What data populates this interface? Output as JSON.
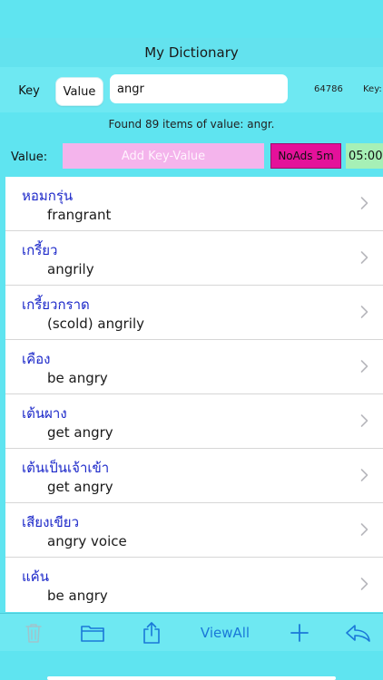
{
  "header": {
    "title": "My Dictionary"
  },
  "segment": {
    "key_label": "Key",
    "value_label": "Value",
    "selected": "Value"
  },
  "search": {
    "value": "angr",
    "placeholder": ""
  },
  "stats": {
    "count": "64786",
    "key_label_partial": "Key:"
  },
  "found_text": "Found 89 items of value: angr.",
  "value_row": {
    "label": "Value:",
    "placeholder": "Add Key-Value",
    "noads_label": "NoAds 5m",
    "timer": "05:00"
  },
  "entries": [
    {
      "key": "หอมกรุ่น",
      "value": "frangrant"
    },
    {
      "key": "เกรี้ยว",
      "value": "angrily"
    },
    {
      "key": "เกรี้ยวกราด",
      "value": "(scold) angrily"
    },
    {
      "key": "เคือง",
      "value": "be angry"
    },
    {
      "key": "เต้นผาง",
      "value": "get angry"
    },
    {
      "key": "เต้นเป็นเจ้าเข้า",
      "value": "get angry"
    },
    {
      "key": "เสียงเขียว",
      "value": "angry voice"
    },
    {
      "key": "แค้น",
      "value": "be angry"
    }
  ],
  "toolbar": {
    "viewall_label": "ViewAll",
    "icons": [
      "trash-icon",
      "folder-icon",
      "share-icon",
      "plus-icon",
      "reply-icon"
    ]
  },
  "colors": {
    "background": "#5fe4f0",
    "key_text": "#1b27c9",
    "accent": "#1a78d8",
    "value_field": "#f4b4ec",
    "noads": "#e4119a",
    "timer": "#a6f0b6"
  }
}
